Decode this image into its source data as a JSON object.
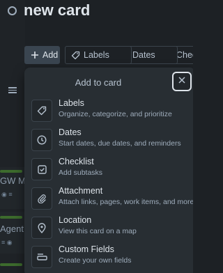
{
  "card": {
    "title": "new card"
  },
  "actions": {
    "add": "Add",
    "labels": "Labels",
    "dates": "Dates",
    "checklist": "Checkl"
  },
  "popover": {
    "title": "Add to card",
    "items": [
      {
        "label": "Labels",
        "description": "Organize, categorize, and prioritize",
        "icon": "tag-icon"
      },
      {
        "label": "Dates",
        "description": "Start dates, due dates, and reminders",
        "icon": "clock-icon"
      },
      {
        "label": "Checklist",
        "description": "Add subtasks",
        "icon": "checkbox-icon"
      },
      {
        "label": "Attachment",
        "description": "Attach links, pages, work items, and more",
        "icon": "paperclip-icon"
      },
      {
        "label": "Location",
        "description": "View this card on a map",
        "icon": "map-pin-icon"
      },
      {
        "label": "Custom Fields",
        "description": "Create your own fields",
        "icon": "fields-icon"
      }
    ]
  },
  "background": {
    "card_one_text": "GW M",
    "card_two_text": "Agent"
  },
  "colors": {
    "page_bg": "#1d2125",
    "popover_bg": "#282e33",
    "primary_text": "#dee4ea",
    "secondary_text": "#9fadbc"
  }
}
